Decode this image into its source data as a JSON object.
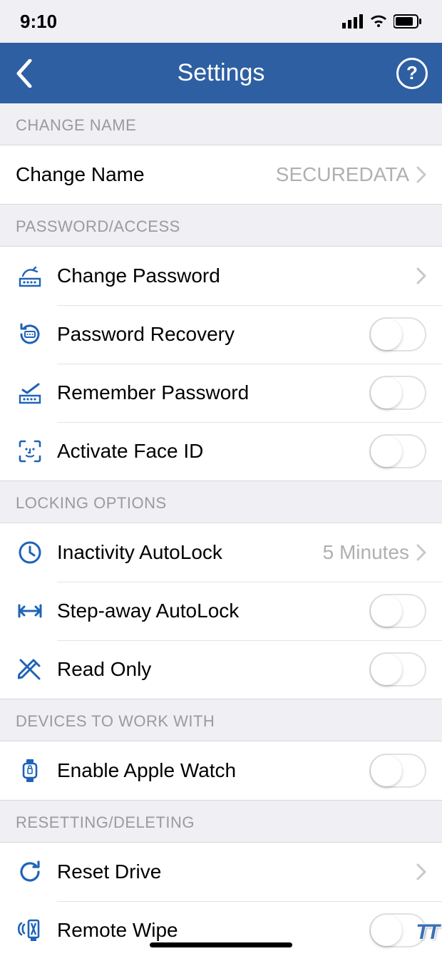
{
  "statusbar": {
    "time": "9:10"
  },
  "nav": {
    "title": "Settings",
    "help": "?"
  },
  "sections": {
    "changeName": {
      "header": "CHANGE NAME",
      "row": {
        "label": "Change Name",
        "value": "SECUREDATA"
      }
    },
    "password": {
      "header": "PASSWORD/ACCESS",
      "changePassword": "Change Password",
      "recovery": "Password Recovery",
      "remember": "Remember Password",
      "faceid": "Activate Face ID"
    },
    "locking": {
      "header": "LOCKING OPTIONS",
      "inactivity": {
        "label": "Inactivity AutoLock",
        "value": "5 Minutes"
      },
      "stepaway": "Step-away AutoLock",
      "readonly": "Read Only"
    },
    "devices": {
      "header": "DEVICES TO WORK WITH",
      "watch": "Enable Apple Watch"
    },
    "reset": {
      "header": "RESETTING/DELETING",
      "resetDrive": "Reset Drive",
      "remoteWipe": "Remote Wipe"
    }
  },
  "watermark": "TT"
}
